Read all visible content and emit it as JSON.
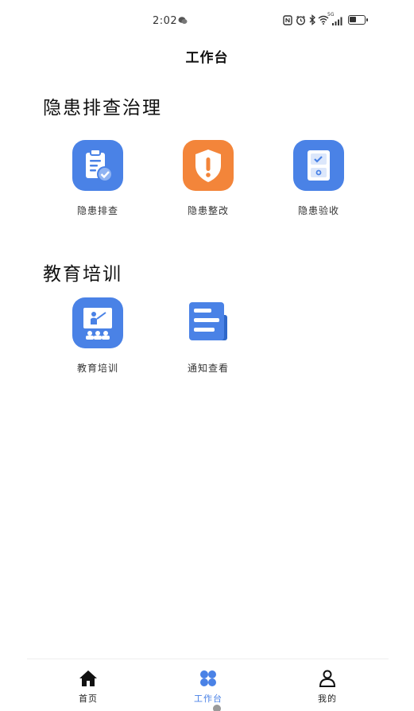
{
  "status_bar": {
    "time": "2:02",
    "network_label": "5G",
    "battery_level": 0.45,
    "icons": [
      "wechat-icon",
      "nfc-icon",
      "alarm-icon",
      "bluetooth-icon",
      "wifi-icon",
      "signal-icon",
      "battery-icon"
    ]
  },
  "header": {
    "title": "工作台"
  },
  "sections": [
    {
      "title": "隐患排查治理",
      "items": [
        {
          "label": "隐患排查",
          "icon": "clipboard-check-icon",
          "color": "#4a82e6"
        },
        {
          "label": "隐患整改",
          "icon": "warning-shield-icon",
          "color": "#f3853a"
        },
        {
          "label": "隐患验收",
          "icon": "checklist-icon",
          "color": "#4a82e6"
        }
      ]
    },
    {
      "title": "教育培训",
      "items": [
        {
          "label": "教育培训",
          "icon": "classroom-icon",
          "color": "#4a82e6"
        },
        {
          "label": "通知查看",
          "icon": "notice-icon",
          "color": "#4a82e6"
        }
      ]
    }
  ],
  "bottom_nav": {
    "active": "工作台",
    "items": [
      {
        "label": "首页",
        "icon": "home-icon"
      },
      {
        "label": "工作台",
        "icon": "grid-icon"
      },
      {
        "label": "我的",
        "icon": "user-icon"
      }
    ]
  },
  "colors": {
    "accent": "#4a82e6",
    "warning": "#f3853a"
  }
}
